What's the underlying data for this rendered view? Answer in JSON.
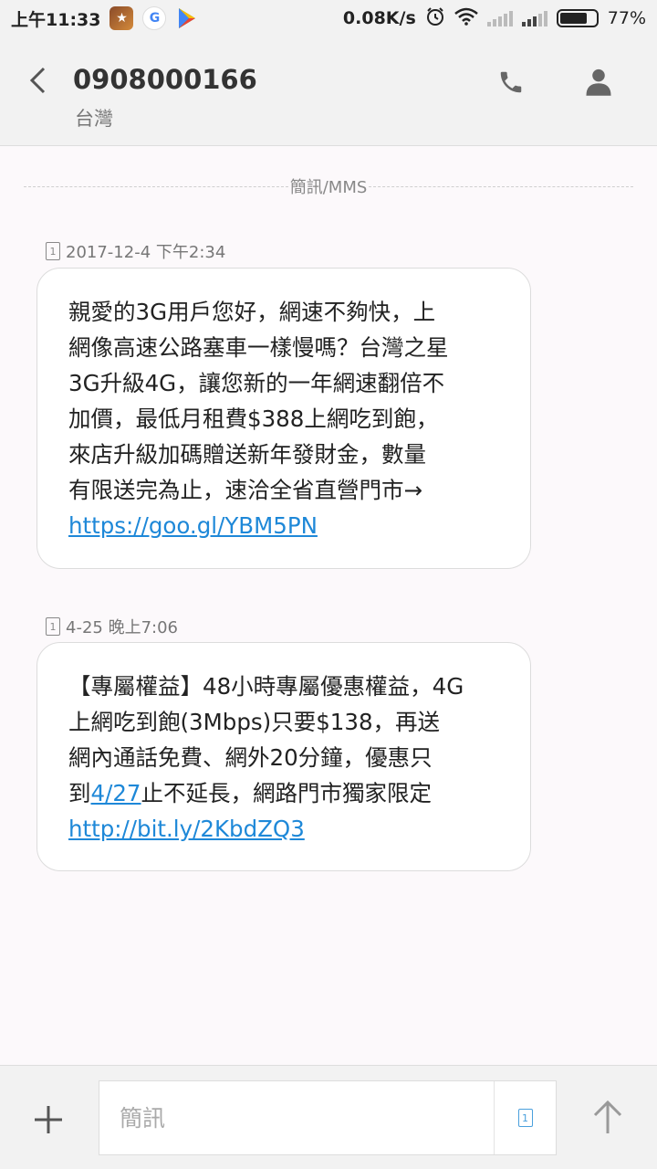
{
  "status_bar": {
    "time": "上午11:33",
    "speed": "0.08K/s",
    "battery_percent": "77%",
    "battery_level": 0.77
  },
  "header": {
    "contact_number": "0908000166",
    "region": "台灣"
  },
  "conversation": {
    "divider_label": "簡訊/MMS",
    "messages": [
      {
        "sim": "1",
        "timestamp": "2017-12-4 下午2:34",
        "text": "親愛的3G用戶您好，網速不夠快，上\n網像高速公路塞車一樣慢嗎？台灣之星\n3G升級4G，讓您新的一年網速翻倍不\n加價，最低月租費$388上網吃到飽，\n來店升級加碼贈送新年發財金，數量\n有限送完為止，速洽全省直營門市→\n",
        "link": "https://goo.gl/YBM5PN"
      },
      {
        "sim": "1",
        "timestamp": "4-25 晚上7:06",
        "text_a": "【專屬權益】48小時專屬優惠權益，4G\n上網吃到飽(3Mbps)只要$138，再送\n網內通話免費、網外20分鐘，優惠只\n到",
        "date_link": "4/27",
        "text_b": "止不延長，網路門市獨家限定\n",
        "link": "http://bit.ly/2KbdZQ3"
      }
    ]
  },
  "composer": {
    "placeholder": "簡訊",
    "sim": "1"
  },
  "colors": {
    "link": "#1e88d8",
    "background": "#fcf9fb",
    "bar": "#f2f2f2"
  }
}
